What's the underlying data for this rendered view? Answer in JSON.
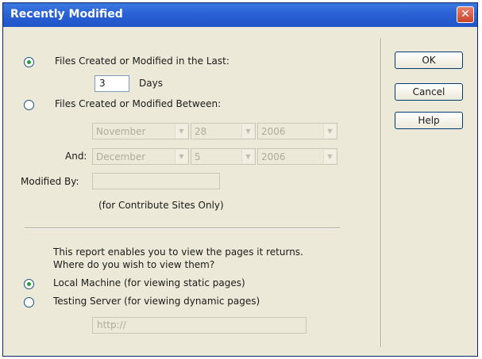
{
  "window": {
    "title": "Recently Modified",
    "close_glyph": "✕"
  },
  "options": {
    "last_label": "Files Created or Modified in the Last:",
    "days_value": "3",
    "days_label": "Days",
    "between_label": "Files Created or Modified Between:",
    "and_label": "And:",
    "from": {
      "month": "November",
      "day": "28",
      "year": "2006"
    },
    "to": {
      "month": "December",
      "day": "5",
      "year": "2006"
    },
    "modified_by_label": "Modified By:",
    "modified_by_value": "",
    "contribute_note": "(for Contribute Sites Only)",
    "selected_range_option": "last"
  },
  "report": {
    "text_line1": "This report enables you to view the pages it returns.",
    "text_line2": "Where do you wish to view them?",
    "local_label": "Local Machine (for viewing static pages)",
    "testing_label": "Testing Server (for viewing dynamic pages)",
    "url_value": "http://",
    "selected_view_option": "local"
  },
  "buttons": {
    "ok": "OK",
    "cancel": "Cancel",
    "help": "Help"
  },
  "icons": {
    "dropdown_arrow": "▼"
  },
  "colors": {
    "titlebar": "#2a62d6",
    "close": "#c8442a",
    "radio_selected": "#2a9a3a",
    "dialog_bg": "#ece9d8"
  }
}
